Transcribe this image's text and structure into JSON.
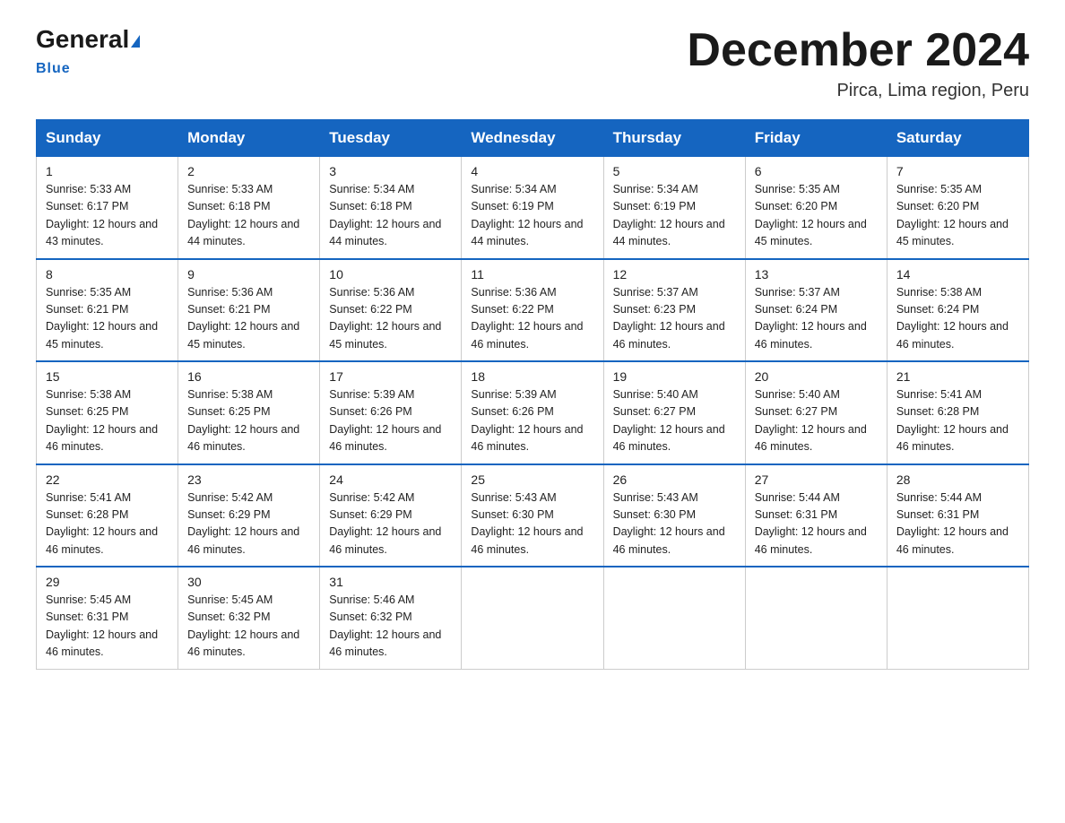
{
  "logo": {
    "general": "General",
    "triangle": "",
    "blue_label": "Blue"
  },
  "title": "December 2024",
  "location": "Pirca, Lima region, Peru",
  "days_header": [
    "Sunday",
    "Monday",
    "Tuesday",
    "Wednesday",
    "Thursday",
    "Friday",
    "Saturday"
  ],
  "weeks": [
    [
      {
        "day": "1",
        "sunrise": "5:33 AM",
        "sunset": "6:17 PM",
        "daylight": "12 hours and 43 minutes."
      },
      {
        "day": "2",
        "sunrise": "5:33 AM",
        "sunset": "6:18 PM",
        "daylight": "12 hours and 44 minutes."
      },
      {
        "day": "3",
        "sunrise": "5:34 AM",
        "sunset": "6:18 PM",
        "daylight": "12 hours and 44 minutes."
      },
      {
        "day": "4",
        "sunrise": "5:34 AM",
        "sunset": "6:19 PM",
        "daylight": "12 hours and 44 minutes."
      },
      {
        "day": "5",
        "sunrise": "5:34 AM",
        "sunset": "6:19 PM",
        "daylight": "12 hours and 44 minutes."
      },
      {
        "day": "6",
        "sunrise": "5:35 AM",
        "sunset": "6:20 PM",
        "daylight": "12 hours and 45 minutes."
      },
      {
        "day": "7",
        "sunrise": "5:35 AM",
        "sunset": "6:20 PM",
        "daylight": "12 hours and 45 minutes."
      }
    ],
    [
      {
        "day": "8",
        "sunrise": "5:35 AM",
        "sunset": "6:21 PM",
        "daylight": "12 hours and 45 minutes."
      },
      {
        "day": "9",
        "sunrise": "5:36 AM",
        "sunset": "6:21 PM",
        "daylight": "12 hours and 45 minutes."
      },
      {
        "day": "10",
        "sunrise": "5:36 AM",
        "sunset": "6:22 PM",
        "daylight": "12 hours and 45 minutes."
      },
      {
        "day": "11",
        "sunrise": "5:36 AM",
        "sunset": "6:22 PM",
        "daylight": "12 hours and 46 minutes."
      },
      {
        "day": "12",
        "sunrise": "5:37 AM",
        "sunset": "6:23 PM",
        "daylight": "12 hours and 46 minutes."
      },
      {
        "day": "13",
        "sunrise": "5:37 AM",
        "sunset": "6:24 PM",
        "daylight": "12 hours and 46 minutes."
      },
      {
        "day": "14",
        "sunrise": "5:38 AM",
        "sunset": "6:24 PM",
        "daylight": "12 hours and 46 minutes."
      }
    ],
    [
      {
        "day": "15",
        "sunrise": "5:38 AM",
        "sunset": "6:25 PM",
        "daylight": "12 hours and 46 minutes."
      },
      {
        "day": "16",
        "sunrise": "5:38 AM",
        "sunset": "6:25 PM",
        "daylight": "12 hours and 46 minutes."
      },
      {
        "day": "17",
        "sunrise": "5:39 AM",
        "sunset": "6:26 PM",
        "daylight": "12 hours and 46 minutes."
      },
      {
        "day": "18",
        "sunrise": "5:39 AM",
        "sunset": "6:26 PM",
        "daylight": "12 hours and 46 minutes."
      },
      {
        "day": "19",
        "sunrise": "5:40 AM",
        "sunset": "6:27 PM",
        "daylight": "12 hours and 46 minutes."
      },
      {
        "day": "20",
        "sunrise": "5:40 AM",
        "sunset": "6:27 PM",
        "daylight": "12 hours and 46 minutes."
      },
      {
        "day": "21",
        "sunrise": "5:41 AM",
        "sunset": "6:28 PM",
        "daylight": "12 hours and 46 minutes."
      }
    ],
    [
      {
        "day": "22",
        "sunrise": "5:41 AM",
        "sunset": "6:28 PM",
        "daylight": "12 hours and 46 minutes."
      },
      {
        "day": "23",
        "sunrise": "5:42 AM",
        "sunset": "6:29 PM",
        "daylight": "12 hours and 46 minutes."
      },
      {
        "day": "24",
        "sunrise": "5:42 AM",
        "sunset": "6:29 PM",
        "daylight": "12 hours and 46 minutes."
      },
      {
        "day": "25",
        "sunrise": "5:43 AM",
        "sunset": "6:30 PM",
        "daylight": "12 hours and 46 minutes."
      },
      {
        "day": "26",
        "sunrise": "5:43 AM",
        "sunset": "6:30 PM",
        "daylight": "12 hours and 46 minutes."
      },
      {
        "day": "27",
        "sunrise": "5:44 AM",
        "sunset": "6:31 PM",
        "daylight": "12 hours and 46 minutes."
      },
      {
        "day": "28",
        "sunrise": "5:44 AM",
        "sunset": "6:31 PM",
        "daylight": "12 hours and 46 minutes."
      }
    ],
    [
      {
        "day": "29",
        "sunrise": "5:45 AM",
        "sunset": "6:31 PM",
        "daylight": "12 hours and 46 minutes."
      },
      {
        "day": "30",
        "sunrise": "5:45 AM",
        "sunset": "6:32 PM",
        "daylight": "12 hours and 46 minutes."
      },
      {
        "day": "31",
        "sunrise": "5:46 AM",
        "sunset": "6:32 PM",
        "daylight": "12 hours and 46 minutes."
      },
      null,
      null,
      null,
      null
    ]
  ]
}
